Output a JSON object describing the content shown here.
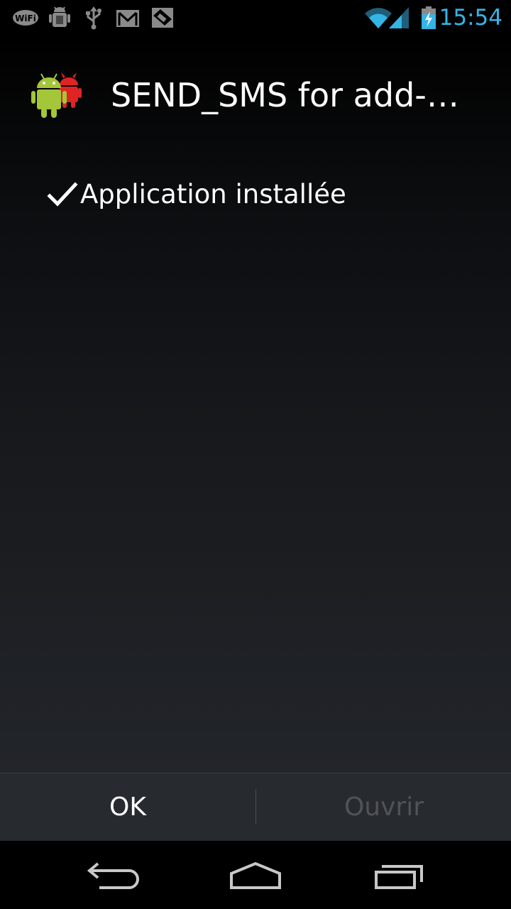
{
  "status_bar": {
    "time": "15:54",
    "time_color": "#33b5e5",
    "notification_icons": [
      "wifi-notification-icon",
      "debug-android-icon",
      "usb-icon",
      "gmail-icon",
      "screenshot-icon"
    ],
    "system_icons": [
      "wifi-signal-icon",
      "cell-signal-icon",
      "battery-charging-icon"
    ]
  },
  "dialog": {
    "app_icon": "android-app-icon",
    "title": "SEND_SMS for add-…",
    "check_icon": "checkmark-icon",
    "status_text": "Application installée"
  },
  "buttons": {
    "ok_label": "OK",
    "open_label": "Ouvrir"
  },
  "nav_bar": {
    "back": "back-icon",
    "home": "home-icon",
    "recents": "recent-apps-icon"
  },
  "colors": {
    "background_top": "#000000",
    "background_bottom": "#22252a",
    "button_bar": "#272a2f",
    "disabled_text": "#505358"
  }
}
